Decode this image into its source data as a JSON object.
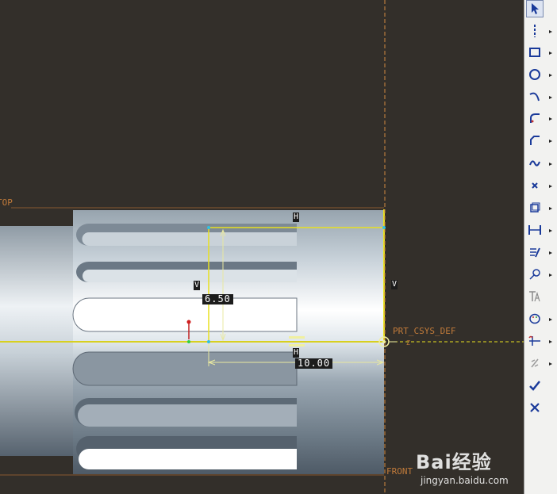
{
  "viewport": {
    "datum_top": "TOP",
    "datum_front": "FRONT",
    "csys_label": "PRT_CSYS_DEF",
    "csys_axis_marker": "Z",
    "constraint_h": "H",
    "constraint_v": "V",
    "dim_height": "6.50",
    "dim_width": "10.00"
  },
  "toolbar": {
    "tools": [
      {
        "icon": "select-arrow-icon"
      },
      {
        "icon": "centerline-icon"
      },
      {
        "icon": "rectangle-icon"
      },
      {
        "icon": "circle-icon"
      },
      {
        "icon": "arc-icon"
      },
      {
        "icon": "fillet-icon"
      },
      {
        "icon": "chamfer-icon"
      },
      {
        "icon": "spline-icon"
      },
      {
        "icon": "point-icon"
      },
      {
        "icon": "offset-edge-icon"
      },
      {
        "icon": "dimension-icon"
      },
      {
        "icon": "modify-icon"
      },
      {
        "icon": "constraint-icon"
      },
      {
        "icon": "text-icon"
      },
      {
        "icon": "palette-icon"
      },
      {
        "icon": "trim-icon"
      },
      {
        "icon": "mirror-icon"
      },
      {
        "icon": "accept-check-icon"
      },
      {
        "icon": "cancel-x-icon"
      }
    ]
  },
  "watermark": {
    "brand": "Bai经验",
    "url": "jingyan.baidu.com"
  }
}
